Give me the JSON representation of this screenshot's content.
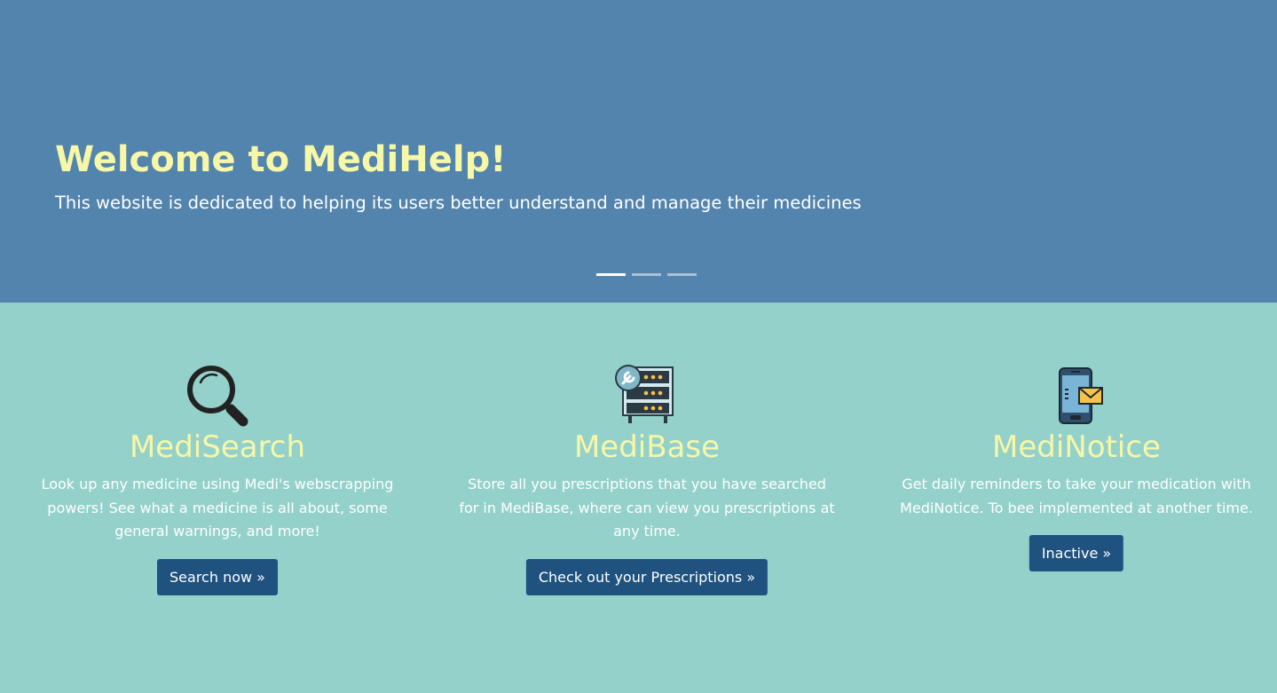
{
  "hero": {
    "title": "Welcome to MediHelp!",
    "subtitle": "This website is dedicated to helping its users better understand and manage their medicines",
    "slide_count": 3,
    "active_slide": 1,
    "background": "#5384ad"
  },
  "features": [
    {
      "title": "MediSearch",
      "icon": "magnifying-glass-icon",
      "description": "Look up any medicine using Medi's webscrapping powers! See what a medicine is all about, some general warnings, and more!",
      "button_label": "Search now »"
    },
    {
      "title": "MediBase",
      "icon": "database-server-icon",
      "description": "Store all you prescriptions that you have searched for in MediBase, where can view you prescriptions at any time.",
      "button_label": "Check out your Prescriptions »"
    },
    {
      "title": "MediNotice",
      "icon": "phone-notification-icon",
      "description": "Get daily reminders to take your medication with MediNotice. To bee implemented at another time.",
      "button_label": "Inactive »"
    }
  ],
  "colors": {
    "hero_bg": "#5384ad",
    "features_bg": "#94d1cb",
    "accent_text": "#f7f7a8",
    "button_bg": "#1f527f"
  }
}
